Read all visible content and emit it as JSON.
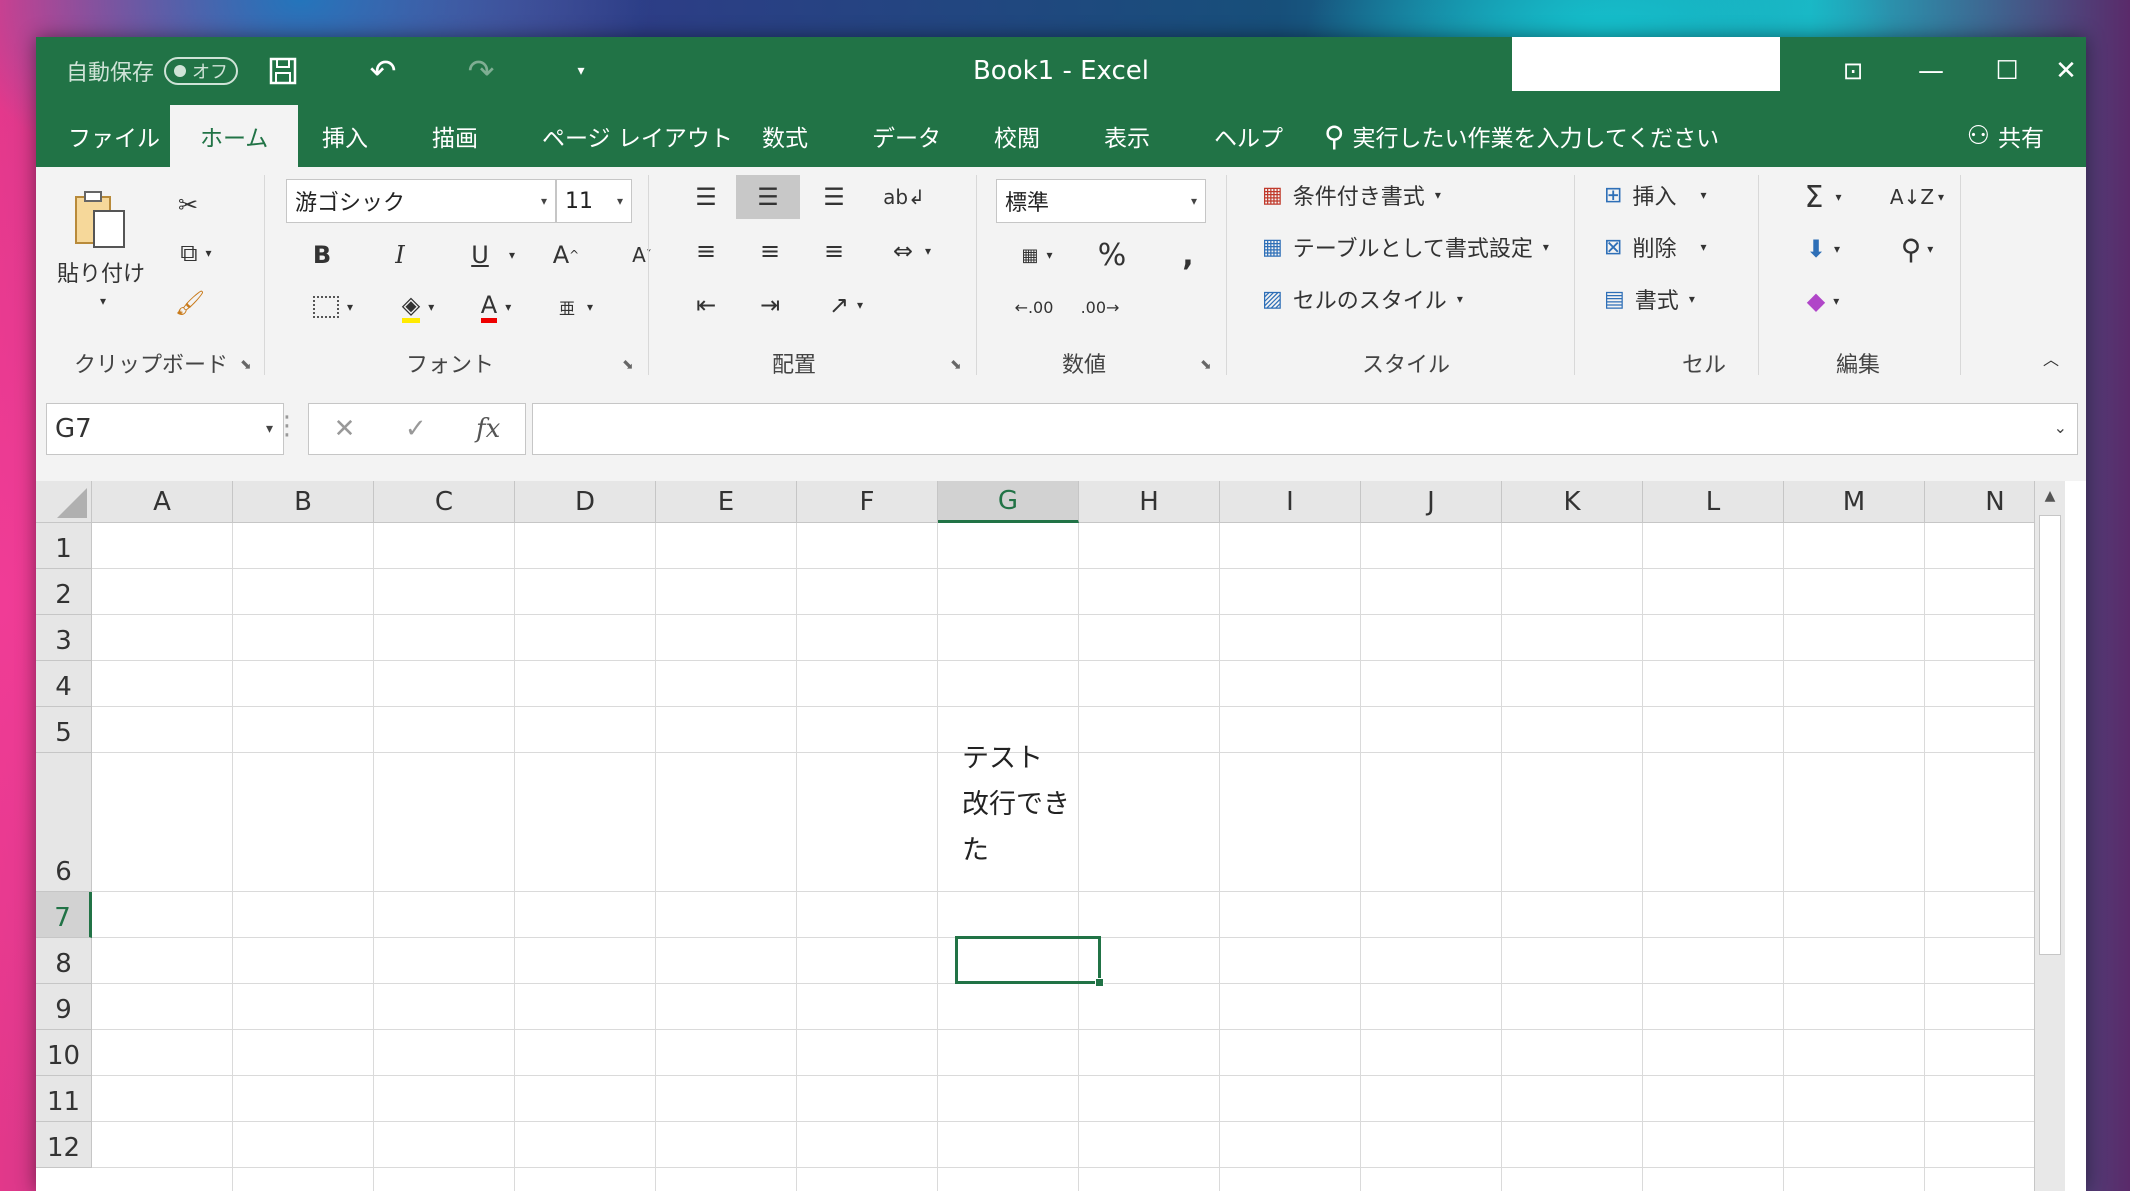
{
  "window": {
    "title": "Book1  -  Excel",
    "autosave_label": "自動保存",
    "autosave_state": "オフ"
  },
  "tabs": [
    "ファイル",
    "ホーム",
    "挿入",
    "描画",
    "ページ レイアウト",
    "数式",
    "データ",
    "校閲",
    "表示",
    "ヘルプ"
  ],
  "active_tab": "ホーム",
  "tellme_placeholder": "実行したい作業を入力してください",
  "share_label": "共有",
  "ribbon": {
    "clipboard": {
      "label": "クリップボード",
      "paste": "貼り付け"
    },
    "font": {
      "label": "フォント",
      "family": "游ゴシック",
      "size": "11",
      "bold": "B",
      "italic": "I",
      "underline": "U"
    },
    "alignment": {
      "label": "配置"
    },
    "number": {
      "label": "数値",
      "format": "標準"
    },
    "styles": {
      "label": "スタイル",
      "conditional": "条件付き書式",
      "table": "テーブルとして書式設定",
      "cell_styles": "セルのスタイル"
    },
    "cells": {
      "label": "セル",
      "insert": "挿入",
      "delete": "削除",
      "format": "書式"
    },
    "editing": {
      "label": "編集"
    }
  },
  "formula_bar": {
    "name_box": "G7",
    "fx": "fx",
    "formula": ""
  },
  "sheet": {
    "columns": [
      "A",
      "B",
      "C",
      "D",
      "E",
      "F",
      "G",
      "H",
      "I",
      "J",
      "K",
      "L",
      "M",
      "N"
    ],
    "active_column": "G",
    "rows": [
      "1",
      "2",
      "3",
      "4",
      "5",
      "6",
      "7",
      "8",
      "9",
      "10",
      "11",
      "12"
    ],
    "active_row": "7",
    "cell_G6": {
      "line1": "テスト",
      "line2": "改行でき",
      "line3": "た"
    }
  }
}
